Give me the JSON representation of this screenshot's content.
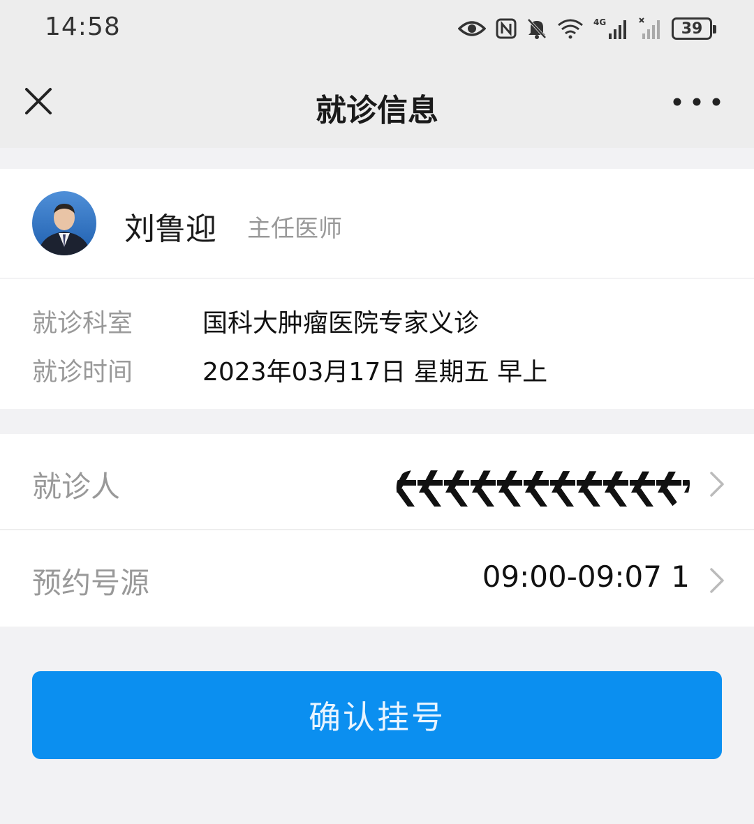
{
  "status_bar": {
    "time": "14:58",
    "icons": [
      "eye-icon",
      "nfc-icon",
      "mute-bell-icon",
      "wifi-icon",
      "4g-signal-icon",
      "signal-icon",
      "battery-icon"
    ],
    "network_label": "4G",
    "battery_level": "39"
  },
  "header": {
    "title": "就诊信息",
    "close_icon": "close-icon",
    "more_icon": "more-icon"
  },
  "doctor": {
    "name": "刘鲁迎",
    "title": "主任医师"
  },
  "visit_info": {
    "department_label": "就诊科室",
    "department_value": "国科大肿瘤医院专家义诊",
    "time_label": "就诊时间",
    "time_value": "2023年03月17日 星期五 早上"
  },
  "patient": {
    "label": "就诊人"
  },
  "appointment": {
    "label": "预约号源",
    "value": "09:00-09:07 1"
  },
  "confirm_button": {
    "label": "确认挂号"
  },
  "colors": {
    "primary": "#0b8ff0",
    "background": "#f2f2f4",
    "header_bg": "#ededed",
    "muted_text": "#999999"
  }
}
